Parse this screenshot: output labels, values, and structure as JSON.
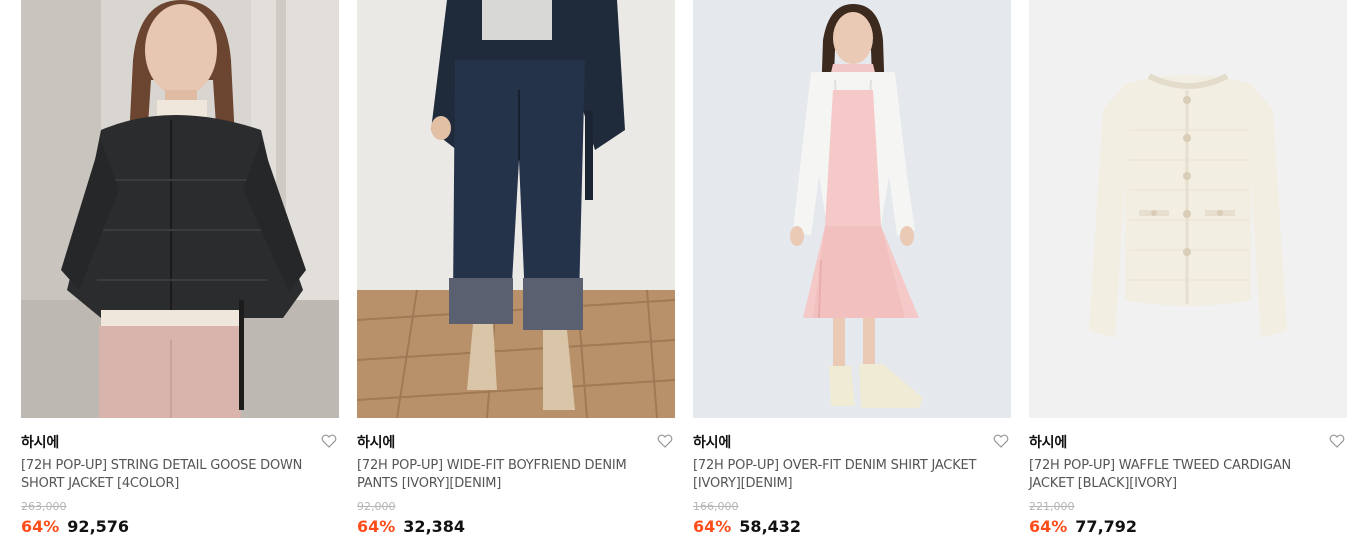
{
  "accent_color": "#ff4d1c",
  "products": [
    {
      "image_alt": "black down short jacket on model",
      "brand": "하시에",
      "name": "[72H POP-UP] STRING DETAIL GOOSE DOWN SHORT JACKET [4COLOR]",
      "original_price": "263,000",
      "discount": "64%",
      "sale_price": "92,576"
    },
    {
      "image_alt": "wide-fit denim pants on model",
      "brand": "하시에",
      "name": "[72H POP-UP] WIDE-FIT BOYFRIEND DENIM PANTS [IVORY][DENIM]",
      "original_price": "92,000",
      "discount": "64%",
      "sale_price": "32,384"
    },
    {
      "image_alt": "white denim shirt jacket over pink dress on model",
      "brand": "하시에",
      "name": "[72H POP-UP] OVER-FIT DENIM SHIRT JACKET [IVORY][DENIM]",
      "original_price": "166,000",
      "discount": "64%",
      "sale_price": "58,432"
    },
    {
      "image_alt": "ivory waffle tweed cardigan jacket",
      "brand": "하시에",
      "name": "[72H POP-UP] WAFFLE TWEED CARDIGAN JACKET [BLACK][IVORY]",
      "original_price": "221,000",
      "discount": "64%",
      "sale_price": "77,792"
    }
  ]
}
